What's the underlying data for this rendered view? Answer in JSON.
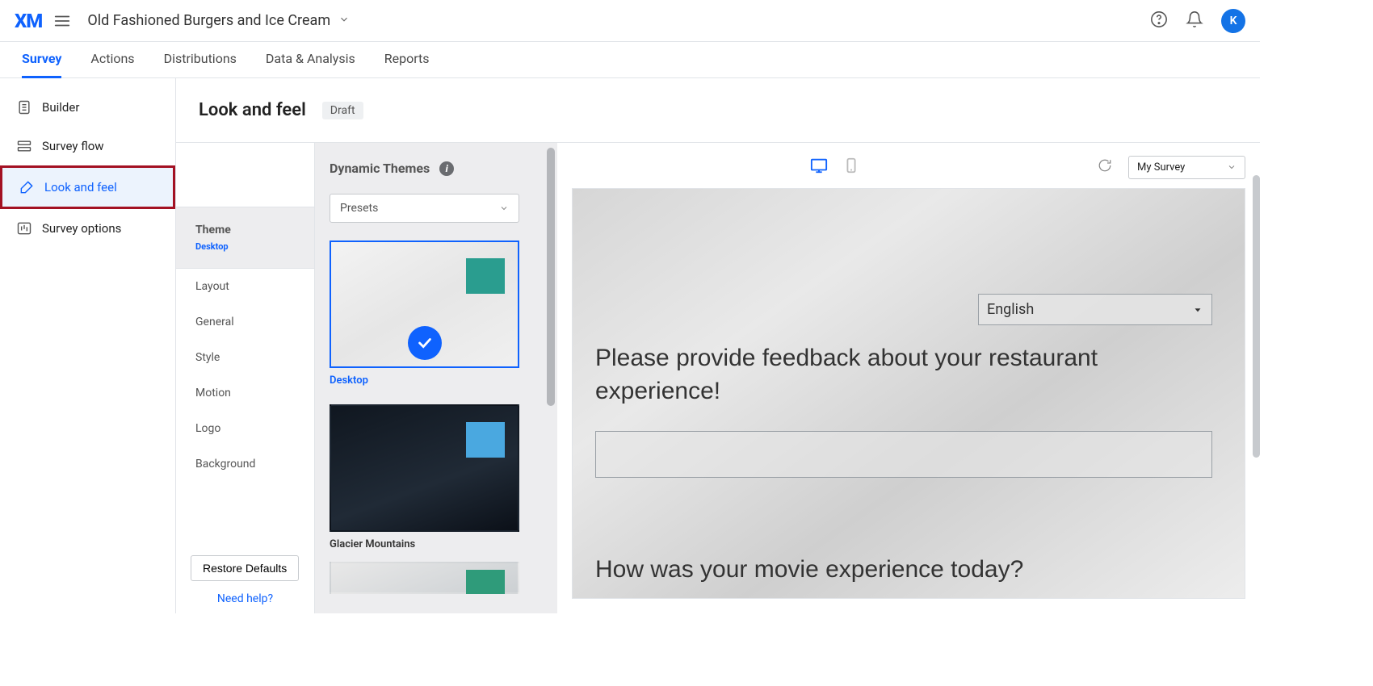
{
  "header": {
    "brand": "XM",
    "project_title": "Old Fashioned Burgers and Ice Cream",
    "avatar_initial": "K"
  },
  "tabs": [
    {
      "label": "Survey",
      "active": true
    },
    {
      "label": "Actions",
      "active": false
    },
    {
      "label": "Distributions",
      "active": false
    },
    {
      "label": "Data & Analysis",
      "active": false
    },
    {
      "label": "Reports",
      "active": false
    }
  ],
  "leftnav": {
    "items": [
      {
        "label": "Builder"
      },
      {
        "label": "Survey flow"
      },
      {
        "label": "Look and feel"
      },
      {
        "label": "Survey options"
      }
    ]
  },
  "page": {
    "title": "Look and feel",
    "badge": "Draft"
  },
  "settings_sidebar": {
    "theme_section": {
      "title": "Theme",
      "sub": "Desktop"
    },
    "items": [
      {
        "label": "Layout"
      },
      {
        "label": "General"
      },
      {
        "label": "Style"
      },
      {
        "label": "Motion"
      },
      {
        "label": "Logo"
      },
      {
        "label": "Background"
      }
    ],
    "restore_label": "Restore Defaults",
    "need_help_label": "Need help?"
  },
  "theme_gallery": {
    "title": "Dynamic Themes",
    "presets_label": "Presets",
    "themes": [
      {
        "label": "Desktop",
        "swatch": "#2a9d8f",
        "active": true
      },
      {
        "label": "Glacier Mountains",
        "swatch": "#4aa8e0",
        "active": false
      },
      {
        "label": "",
        "swatch": "#2f9b7a",
        "active": false
      }
    ]
  },
  "preview": {
    "survey_dropdown": "My Survey",
    "language": "English",
    "q1": "Please provide feedback about your restaurant experience!",
    "q2": "How was your movie experience today?"
  }
}
